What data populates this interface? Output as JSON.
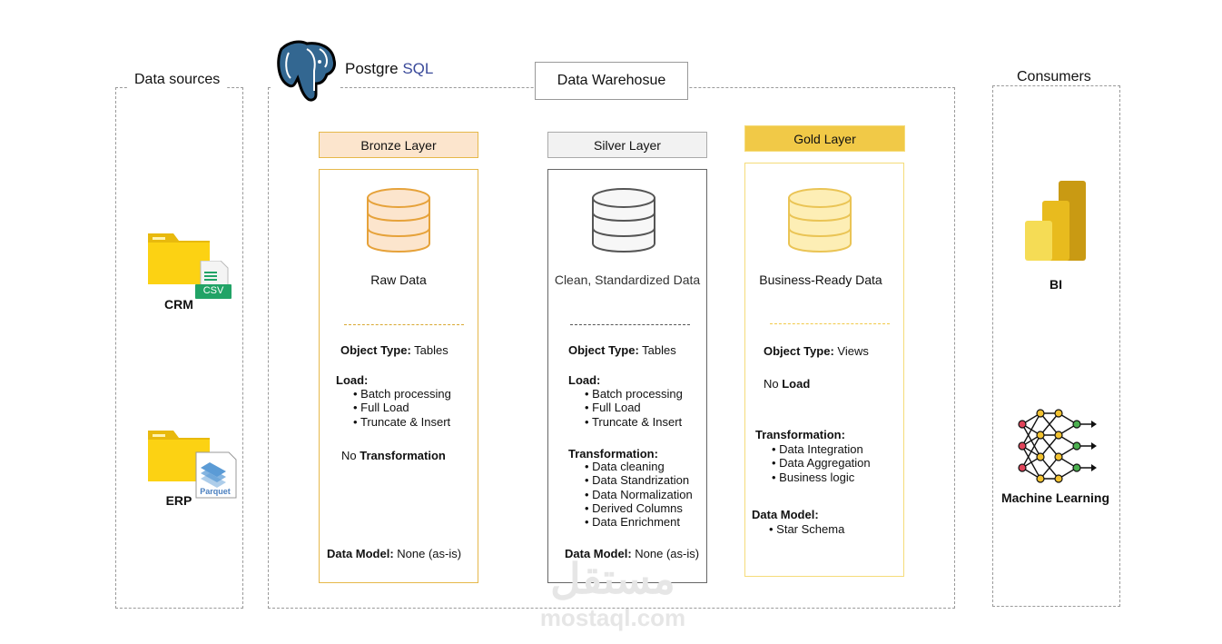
{
  "sources": {
    "title": "Data sources",
    "items": [
      {
        "name": "CRM",
        "badge": "CSV"
      },
      {
        "name": "ERP",
        "badge": "Parquet"
      }
    ]
  },
  "warehouse": {
    "title": "Data Warehosue",
    "logo_text_a": "Postgre",
    "logo_text_b": "SQL"
  },
  "layers": [
    {
      "header": "Bronze Layer",
      "caption": "Raw Data",
      "object_type_label": "Object Type:",
      "object_type_value": " Tables",
      "load_label": "Load:",
      "load_items": [
        "Batch processing",
        "Full Load",
        "Truncate & Insert"
      ],
      "transform_prefix": "No ",
      "transform_label": "Transformation",
      "data_model_label": "Data Model:",
      "data_model_value": " None (as-is)"
    },
    {
      "header": "Silver Layer",
      "caption": "Clean, Standardized Data",
      "object_type_label": "Object Type:",
      "object_type_value": " Tables",
      "load_label": "Load:",
      "load_items": [
        "Batch processing",
        "Full Load",
        "Truncate & Insert"
      ],
      "transform_label": "Transformation:",
      "transform_items": [
        "Data cleaning",
        "Data Standrization",
        "Data Normalization",
        "Derived Columns",
        "Data Enrichment"
      ],
      "data_model_label": "Data Model:",
      "data_model_value": " None (as-is)"
    },
    {
      "header": "Gold Layer",
      "caption": "Business-Ready Data",
      "object_type_label": "Object Type:",
      "object_type_value": " Views",
      "load_prefix": "No ",
      "load_label": "Load",
      "transform_label": "Transformation:",
      "transform_items": [
        "Data Integration",
        "Data Aggregation",
        "Business logic"
      ],
      "data_model_label": "Data Model:",
      "data_model_items": [
        "Star Schema"
      ]
    }
  ],
  "consumers": {
    "title": "Consumers",
    "items": [
      {
        "name": "BI"
      },
      {
        "name": "Machine Learning"
      }
    ]
  },
  "watermark": {
    "text_ar": "مستقل",
    "text_en": "mostaql.com"
  },
  "colors": {
    "bronze_fill": "#fce5cd",
    "bronze_border": "#e6b84a",
    "silver_fill": "#f2f2f2",
    "silver_border": "#666666",
    "gold_fill": "#f1c947",
    "gold_border": "#f5dc7a",
    "folder": "#fcd213",
    "csv_green": "#21a366",
    "pg_blue": "#336791"
  }
}
